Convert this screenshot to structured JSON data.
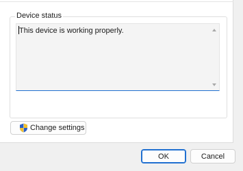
{
  "device_status": {
    "legend": "Device status",
    "text": "This device is working properly."
  },
  "buttons": {
    "change_settings": "Change settings",
    "ok": "OK",
    "cancel": "Cancel"
  },
  "icons": {
    "shield": "uac-shield-icon",
    "scroll_up": "scroll-up-arrow-icon",
    "scroll_down": "scroll-down-arrow-icon"
  },
  "colors": {
    "focus_accent": "#1f6fd0",
    "shield_blue": "#2a5fc8",
    "shield_yellow": "#f2c12e"
  }
}
